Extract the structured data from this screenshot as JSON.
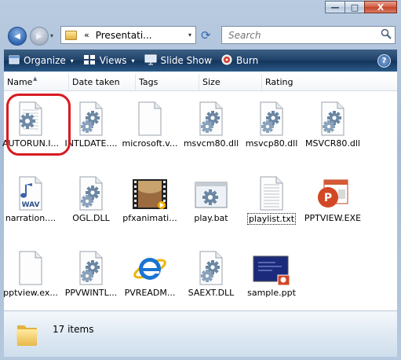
{
  "window": {
    "caption_buttons": {
      "minimize_glyph": "—",
      "maximize_glyph": "□",
      "close_glyph": "X"
    }
  },
  "address": {
    "chevron": "«",
    "path": "Presentati...",
    "dropdown_glyph": "▾",
    "refresh_glyph": "⟳"
  },
  "search": {
    "placeholder": "Search",
    "icon": "magnifier-icon"
  },
  "nav": {
    "back_glyph": "◀",
    "forward_glyph": "▶",
    "dropdown_glyph": "▾"
  },
  "toolbar": {
    "organize": "Organize",
    "views": "Views",
    "slideshow": "Slide Show",
    "burn": "Burn",
    "help": "?",
    "dropdown_glyph": "▾"
  },
  "columns": [
    "Name",
    "Date taken",
    "Tags",
    "Size",
    "Rating"
  ],
  "files": [
    {
      "label": "AUTORUN.I...",
      "icon": "settings-file-icon"
    },
    {
      "label": "INTLDATE....",
      "icon": "dll-gear-icon"
    },
    {
      "label": "microsoft.v...",
      "icon": "blank-file-icon"
    },
    {
      "label": "msvcm80.dll",
      "icon": "dll-gear-icon"
    },
    {
      "label": "msvcp80.dll",
      "icon": "dll-gear-icon"
    },
    {
      "label": "MSVCR80.dll",
      "icon": "dll-gear-icon"
    },
    {
      "label": "narration....",
      "icon": "wav-audio-icon",
      "badge": "WAV"
    },
    {
      "label": "OGL.DLL",
      "icon": "dll-gear-icon"
    },
    {
      "label": "pfxanimati...",
      "icon": "video-filmstrip-icon"
    },
    {
      "label": "play.bat",
      "icon": "batch-file-icon"
    },
    {
      "label": "playlist.txt",
      "icon": "text-file-icon"
    },
    {
      "label": "PPTVIEW.EXE",
      "icon": "powerpoint-viewer-icon"
    },
    {
      "label": "pptview.ex...",
      "icon": "blank-file-icon"
    },
    {
      "label": "PPVWINTL...",
      "icon": "dll-gear-icon"
    },
    {
      "label": "PVREADM...",
      "icon": "internet-explorer-icon"
    },
    {
      "label": "SAEXT.DLL",
      "icon": "dll-gear-icon"
    },
    {
      "label": "sample.ppt",
      "icon": "presentation-thumbnail-icon"
    }
  ],
  "status": {
    "item_count": "17 items"
  },
  "colors": {
    "highlight": "#d81b22",
    "toolbar": "#20426a"
  }
}
